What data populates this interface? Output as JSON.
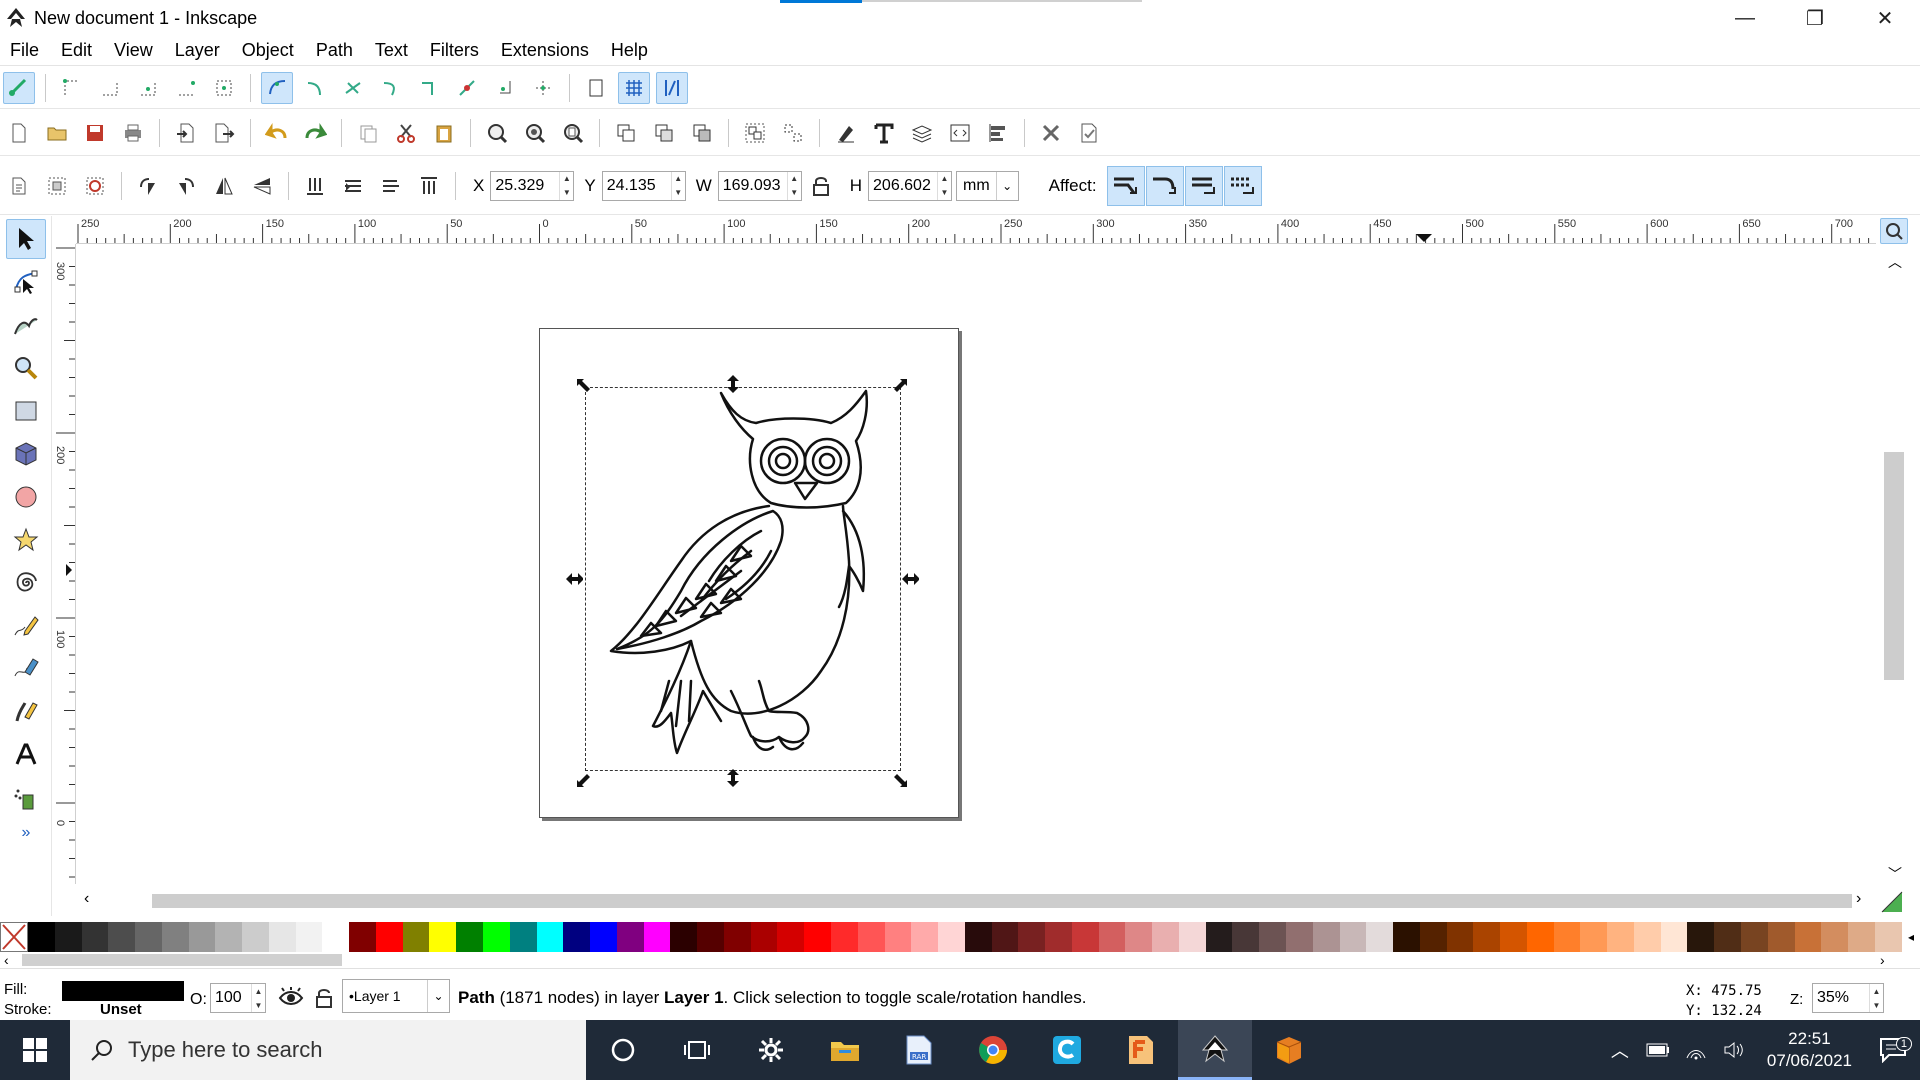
{
  "window": {
    "title": "New document 1 - Inkscape",
    "minimize_glyph": "—",
    "restore_glyph": "❐",
    "close_glyph": "✕"
  },
  "menu": [
    "File",
    "Edit",
    "View",
    "Layer",
    "Object",
    "Path",
    "Text",
    "Filters",
    "Extensions",
    "Help"
  ],
  "select_toolbar": {
    "x_label": "X",
    "x_value": "25.329",
    "y_label": "Y",
    "y_value": "24.135",
    "w_label": "W",
    "w_value": "169.093",
    "h_label": "H",
    "h_value": "206.602",
    "unit": "mm",
    "affect_label": "Affect:"
  },
  "ruler": {
    "h_ticks": [
      "250",
      "200",
      "150",
      "100",
      "50",
      "0",
      "50",
      "100",
      "150",
      "200",
      "250",
      "300",
      "350",
      "400",
      "450",
      "500",
      "550",
      "600",
      "650",
      "700"
    ],
    "v_ticks": [
      "300",
      "200",
      "100",
      "0"
    ]
  },
  "palette": [
    "#000000",
    "#1a1a1a",
    "#333333",
    "#4d4d4d",
    "#666666",
    "#808080",
    "#999999",
    "#b3b3b3",
    "#cccccc",
    "#e6e6e6",
    "#f2f2f2",
    "#ffffff",
    "#800000",
    "#ff0000",
    "#808000",
    "#ffff00",
    "#008000",
    "#00ff00",
    "#008080",
    "#00ffff",
    "#000080",
    "#0000ff",
    "#800080",
    "#ff00ff",
    "#2b0000",
    "#550000",
    "#800000",
    "#aa0000",
    "#d40000",
    "#ff0000",
    "#ff2a2a",
    "#ff5555",
    "#ff8080",
    "#ffaaaa",
    "#ffd5d5",
    "#280b0b",
    "#501616",
    "#782121",
    "#a02c2c",
    "#c83737",
    "#d35f5f",
    "#de8787",
    "#e9afaf",
    "#f4d7d7",
    "#241c1c",
    "#483737",
    "#6c5353",
    "#916f6f",
    "#ac9393",
    "#c8b7b7",
    "#e3dbdb",
    "#2b1100",
    "#552200",
    "#803300",
    "#aa4400",
    "#d45500",
    "#ff6600",
    "#ff7f2a",
    "#ff9955",
    "#ffb380",
    "#ffccaa",
    "#ffe6d5",
    "#28170b",
    "#502d16",
    "#784421",
    "#a05a2c",
    "#c87137",
    "#d38d5f",
    "#deaa87",
    "#e9c6af"
  ],
  "status": {
    "fill_label": "Fill:",
    "stroke_label": "Stroke:",
    "stroke_value": "Unset",
    "fill_color": "#000000",
    "opacity_label": "O:",
    "opacity_value": "100",
    "layer_value": "•Layer 1",
    "message_bold1": "Path",
    "message_part1": " (1871 nodes) in layer ",
    "message_bold2": "Layer 1",
    "message_part2": ". Click selection to toggle scale/rotation handles.",
    "cursor_x": "X:  475.75",
    "cursor_y": "Y:  132.24",
    "zoom_label": "Z:",
    "zoom_value": "35%"
  },
  "taskbar": {
    "search_placeholder": "Type here to search",
    "time": "22:51",
    "date": "07/06/2021",
    "notification_count": "1"
  }
}
